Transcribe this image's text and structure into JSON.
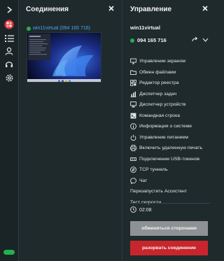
{
  "rail": {
    "items": [
      {
        "icon": "chevron-right-icon"
      },
      {
        "icon": "logo-icon"
      },
      {
        "icon": "list-icon"
      },
      {
        "icon": "user-icon"
      },
      {
        "icon": "headset-icon"
      },
      {
        "icon": "settings-icon"
      }
    ],
    "toggle_color": "#22b14c"
  },
  "connections": {
    "title": "Соединения",
    "items": [
      {
        "label": "win11virtual (094 165 716)",
        "status_color": "#22b14c"
      }
    ]
  },
  "control": {
    "title": "Управление",
    "device_name": "win11virtual",
    "device_id": "094 165 716",
    "menu": [
      {
        "icon": "monitor-icon",
        "label": "Управление экраном"
      },
      {
        "icon": "folder-icon",
        "label": "Обмен файлами"
      },
      {
        "icon": "registry-icon",
        "label": "Редактор реестра"
      },
      {
        "icon": "task-manager-icon",
        "label": "Диспетчер задач"
      },
      {
        "icon": "device-manager-icon",
        "label": "Диспетчер устройств"
      },
      {
        "icon": "terminal-icon",
        "label": "Командная строка"
      },
      {
        "icon": "info-icon",
        "label": "Информация о системе"
      },
      {
        "icon": "power-icon",
        "label": "Управление питанием"
      },
      {
        "icon": "printer-icon",
        "label": "Включить удаленную печать"
      },
      {
        "icon": "usb-icon",
        "label": "Подключение USB-токенов"
      },
      {
        "icon": "tcp-icon",
        "label": "TCP туннель"
      },
      {
        "icon": "chat-icon",
        "label": "Чат"
      },
      {
        "icon": "",
        "label": "Перезапустить Ассистент"
      },
      {
        "icon": "",
        "label": "Тест скорости"
      }
    ],
    "timer": "02:08",
    "swap_button": "обменяться сторонами",
    "disconnect_button": "разорвать соединение"
  }
}
